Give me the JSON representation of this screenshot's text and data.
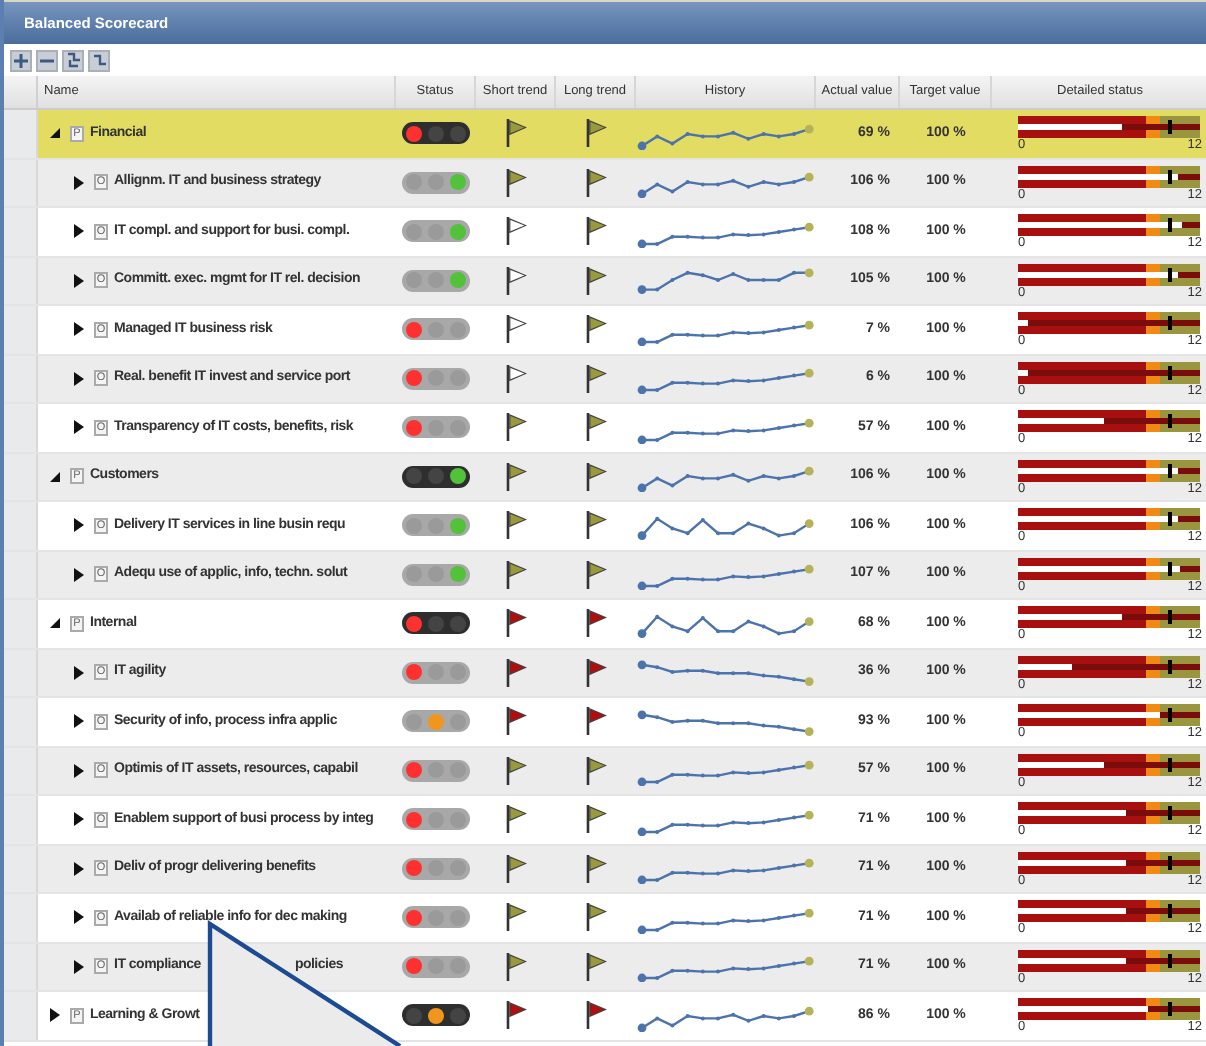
{
  "window": {
    "title": "Balanced Scorecard"
  },
  "toolbar": [
    {
      "kind": "plus"
    },
    {
      "kind": "minus"
    },
    {
      "kind": "expand"
    },
    {
      "kind": "collapse"
    }
  ],
  "columns": [
    "Name",
    "Status",
    "Short trend",
    "Long trend",
    "History",
    "Actual value",
    "Target value",
    "Detailed status"
  ],
  "rows": [
    {
      "kind": "perspective",
      "badge": "P",
      "name": "Financial",
      "expanded": true,
      "selected": true,
      "status": {
        "color": "#ff3030"
      },
      "short_trend": {
        "color": "#9a9a3c"
      },
      "long_trend": {
        "color": "#9a9a3c"
      },
      "history": {
        "kind": "wavy"
      },
      "actual": "69 %",
      "target": "100 %",
      "level": 0.575,
      "scale_min": "0",
      "scale_max": "12"
    },
    {
      "kind": "objective",
      "badge": "O",
      "name": "Allignm. IT and business strategy",
      "expanded": false,
      "selected": false,
      "status": {
        "color": "#52c23a"
      },
      "short_trend": {
        "color": "#9a9a3c"
      },
      "long_trend": {
        "color": "#9a9a3c"
      },
      "history": {
        "kind": "wavy"
      },
      "actual": "106 %",
      "target": "100 %",
      "level": 0.883,
      "scale_min": "0",
      "scale_max": "12"
    },
    {
      "kind": "objective",
      "badge": "O",
      "name": "IT compl. and support for busi. compl.",
      "expanded": false,
      "selected": false,
      "status": {
        "color": "#52c23a"
      },
      "short_trend": {
        "color": "#ffffff"
      },
      "long_trend": {
        "color": "#9a9a3c"
      },
      "history": {
        "kind": "rising"
      },
      "actual": "108 %",
      "target": "100 %",
      "level": 0.9,
      "scale_min": "0",
      "scale_max": "12"
    },
    {
      "kind": "objective",
      "badge": "O",
      "name": "Committ. exec. mgmt for IT rel. decision",
      "expanded": false,
      "selected": false,
      "status": {
        "color": "#52c23a"
      },
      "short_trend": {
        "color": "#ffffff"
      },
      "long_trend": {
        "color": "#9a9a3c"
      },
      "history": {
        "kind": "bump"
      },
      "actual": "105 %",
      "target": "100 %",
      "level": 0.875,
      "scale_min": "0",
      "scale_max": "12"
    },
    {
      "kind": "objective",
      "badge": "O",
      "name": "Managed IT business risk",
      "expanded": false,
      "selected": false,
      "status": {
        "color": "#ff3030"
      },
      "short_trend": {
        "color": "#ffffff"
      },
      "long_trend": {
        "color": "#9a9a3c"
      },
      "history": {
        "kind": "rising"
      },
      "actual": "7 %",
      "target": "100 %",
      "level": 0.058,
      "scale_min": "0",
      "scale_max": "12"
    },
    {
      "kind": "objective",
      "badge": "O",
      "name": "Real. benefit IT invest and service port",
      "expanded": false,
      "selected": false,
      "status": {
        "color": "#ff3030"
      },
      "short_trend": {
        "color": "#ffffff"
      },
      "long_trend": {
        "color": "#9a9a3c"
      },
      "history": {
        "kind": "rising"
      },
      "actual": "6 %",
      "target": "100 %",
      "level": 0.05,
      "scale_min": "0",
      "scale_max": "12"
    },
    {
      "kind": "objective",
      "badge": "O",
      "name": "Transparency of IT costs, benefits, risk",
      "expanded": false,
      "selected": false,
      "status": {
        "color": "#ff3030"
      },
      "short_trend": {
        "color": "#9a9a3c"
      },
      "long_trend": {
        "color": "#9a9a3c"
      },
      "history": {
        "kind": "rising"
      },
      "actual": "57 %",
      "target": "100 %",
      "level": 0.475,
      "scale_min": "0",
      "scale_max": "12"
    },
    {
      "kind": "perspective",
      "badge": "P",
      "name": "Customers",
      "expanded": true,
      "selected": false,
      "status": {
        "color": "#52c23a"
      },
      "short_trend": {
        "color": "#9a9a3c"
      },
      "long_trend": {
        "color": "#9a9a3c"
      },
      "history": {
        "kind": "wavy"
      },
      "actual": "106 %",
      "target": "100 %",
      "level": 0.883,
      "scale_min": "0",
      "scale_max": "12"
    },
    {
      "kind": "objective",
      "badge": "O",
      "name": "Delivery IT services in line busin requ",
      "expanded": false,
      "selected": false,
      "status": {
        "color": "#52c23a"
      },
      "short_trend": {
        "color": "#9a9a3c"
      },
      "long_trend": {
        "color": "#9a9a3c"
      },
      "history": {
        "kind": "zigzag"
      },
      "actual": "106 %",
      "target": "100 %",
      "level": 0.883,
      "scale_min": "0",
      "scale_max": "12"
    },
    {
      "kind": "objective",
      "badge": "O",
      "name": "Adequ use of applic, info, techn. solut",
      "expanded": false,
      "selected": false,
      "status": {
        "color": "#52c23a"
      },
      "short_trend": {
        "color": "#9a9a3c"
      },
      "long_trend": {
        "color": "#9a9a3c"
      },
      "history": {
        "kind": "rising"
      },
      "actual": "107 %",
      "target": "100 %",
      "level": 0.892,
      "scale_min": "0",
      "scale_max": "12"
    },
    {
      "kind": "perspective",
      "badge": "P",
      "name": "Internal",
      "expanded": true,
      "selected": false,
      "status": {
        "color": "#ff3030"
      },
      "short_trend": {
        "color": "#b00d0d"
      },
      "long_trend": {
        "color": "#b00d0d"
      },
      "history": {
        "kind": "zigzag"
      },
      "actual": "68 %",
      "target": "100 %",
      "level": 0.567,
      "scale_min": "0",
      "scale_max": "12"
    },
    {
      "kind": "objective",
      "badge": "O",
      "name": "IT agility",
      "expanded": false,
      "selected": false,
      "status": {
        "color": "#ff3030"
      },
      "short_trend": {
        "color": "#b00d0d"
      },
      "long_trend": {
        "color": "#b00d0d"
      },
      "history": {
        "kind": "falling"
      },
      "actual": "36 %",
      "target": "100 %",
      "level": 0.3,
      "scale_min": "0",
      "scale_max": "12"
    },
    {
      "kind": "objective",
      "badge": "O",
      "name": "Security of info, process infra applic",
      "expanded": false,
      "selected": false,
      "status": {
        "color": "#f0961e"
      },
      "short_trend": {
        "color": "#b00d0d"
      },
      "long_trend": {
        "color": "#b00d0d"
      },
      "history": {
        "kind": "falling"
      },
      "actual": "93 %",
      "target": "100 %",
      "level": 0.775,
      "scale_min": "0",
      "scale_max": "12"
    },
    {
      "kind": "objective",
      "badge": "O",
      "name": "Optimis of IT assets, resources, capabil",
      "expanded": false,
      "selected": false,
      "status": {
        "color": "#ff3030"
      },
      "short_trend": {
        "color": "#9a9a3c"
      },
      "long_trend": {
        "color": "#9a9a3c"
      },
      "history": {
        "kind": "rising"
      },
      "actual": "57 %",
      "target": "100 %",
      "level": 0.475,
      "scale_min": "0",
      "scale_max": "12"
    },
    {
      "kind": "objective",
      "badge": "O",
      "name": "Enablem support of busi process by integ",
      "expanded": false,
      "selected": false,
      "status": {
        "color": "#ff3030"
      },
      "short_trend": {
        "color": "#9a9a3c"
      },
      "long_trend": {
        "color": "#9a9a3c"
      },
      "history": {
        "kind": "rising"
      },
      "actual": "71 %",
      "target": "100 %",
      "level": 0.592,
      "scale_min": "0",
      "scale_max": "12"
    },
    {
      "kind": "objective",
      "badge": "O",
      "name": "Deliv of progr delivering benefits",
      "expanded": false,
      "selected": false,
      "status": {
        "color": "#ff3030"
      },
      "short_trend": {
        "color": "#9a9a3c"
      },
      "long_trend": {
        "color": "#9a9a3c"
      },
      "history": {
        "kind": "rising"
      },
      "actual": "71 %",
      "target": "100 %",
      "level": 0.592,
      "scale_min": "0",
      "scale_max": "12"
    },
    {
      "kind": "objective",
      "badge": "O",
      "name": "Availab of reliable info for dec making",
      "expanded": false,
      "selected": false,
      "status": {
        "color": "#ff3030"
      },
      "short_trend": {
        "color": "#9a9a3c"
      },
      "long_trend": {
        "color": "#9a9a3c"
      },
      "history": {
        "kind": "rising"
      },
      "actual": "71 %",
      "target": "100 %",
      "level": 0.592,
      "scale_min": "0",
      "scale_max": "12"
    },
    {
      "kind": "objective",
      "badge": "O",
      "name": "IT compliance",
      "name_tail": "policies",
      "expanded": false,
      "selected": false,
      "status": {
        "color": "#ff3030"
      },
      "short_trend": {
        "color": "#9a9a3c"
      },
      "long_trend": {
        "color": "#9a9a3c"
      },
      "history": {
        "kind": "rising"
      },
      "actual": "71 %",
      "target": "100 %",
      "level": 0.592,
      "scale_min": "0",
      "scale_max": "12"
    },
    {
      "kind": "perspective",
      "badge": "P",
      "name": "Learning & Growt",
      "expanded": false,
      "selected": false,
      "status": {
        "color": "#f0961e"
      },
      "short_trend": {
        "color": "#b00d0d"
      },
      "long_trend": {
        "color": "#b00d0d"
      },
      "history": {
        "kind": "wavy"
      },
      "actual": "86 %",
      "target": "100 %",
      "level": 0.717,
      "scale_min": "0",
      "scale_max": "12"
    }
  ]
}
